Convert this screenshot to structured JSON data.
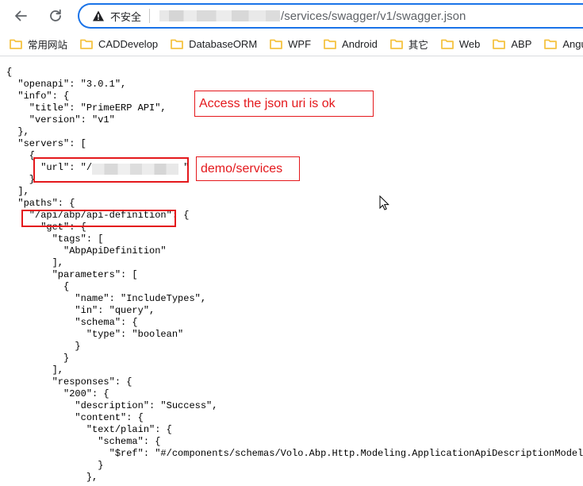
{
  "browser": {
    "security_label": "不安全",
    "url_path": "/services/swagger/v1/swagger.json"
  },
  "bookmarks": [
    {
      "label": "常用网站",
      "cjk": true
    },
    {
      "label": "CADDevelop",
      "cjk": false
    },
    {
      "label": "DatabaseORM",
      "cjk": false
    },
    {
      "label": "WPF",
      "cjk": false
    },
    {
      "label": "Android",
      "cjk": false
    },
    {
      "label": "其它",
      "cjk": true
    },
    {
      "label": "Web",
      "cjk": false
    },
    {
      "label": "ABP",
      "cjk": false
    },
    {
      "label": "Angular",
      "cjk": false
    }
  ],
  "json_lines": [
    "{",
    "  \"openapi\": \"3.0.1\",",
    "  \"info\": {",
    "    \"title\": \"PrimeERP API\",",
    "    \"version\": \"v1\"",
    "  },",
    "  \"servers\": [",
    "    {",
    "      \"url\": \"/                \"",
    "    }",
    "  ],",
    "  \"paths\": {",
    "    \"/api/abp/api-definition\": {",
    "      \"get\": {",
    "        \"tags\": [",
    "          \"AbpApiDefinition\"",
    "        ],",
    "        \"parameters\": [",
    "          {",
    "            \"name\": \"IncludeTypes\",",
    "            \"in\": \"query\",",
    "            \"schema\": {",
    "              \"type\": \"boolean\"",
    "            }",
    "          }",
    "        ],",
    "        \"responses\": {",
    "          \"200\": {",
    "            \"description\": \"Success\",",
    "            \"content\": {",
    "              \"text/plain\": {",
    "                \"schema\": {",
    "                  \"$ref\": \"#/components/schemas/Volo.Abp.Http.Modeling.ApplicationApiDescriptionModel\"",
    "                }",
    "              },"
  ],
  "annotations": {
    "json_ok": "Access the json uri is ok",
    "demo_services": "demo/services"
  },
  "colors": {
    "accent": "#1a73e8",
    "annotation_red": "#e4181c",
    "folder_yellow": "#f5c342"
  }
}
